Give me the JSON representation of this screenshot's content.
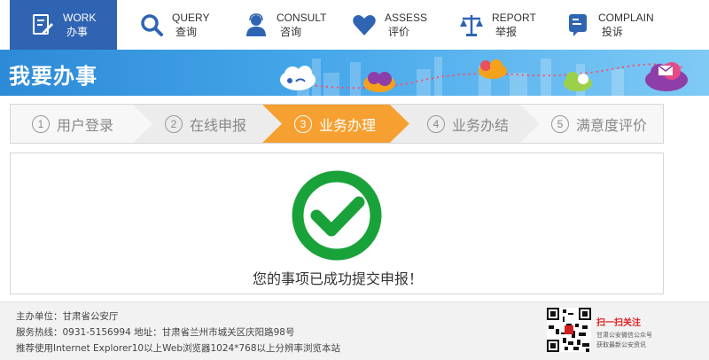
{
  "nav": {
    "items": [
      {
        "en": "WORK",
        "cn": "办事"
      },
      {
        "en": "QUERY",
        "cn": "查询"
      },
      {
        "en": "CONSULT",
        "cn": "咨询"
      },
      {
        "en": "ASSESS",
        "cn": "评价"
      },
      {
        "en": "REPORT",
        "cn": "举报"
      },
      {
        "en": "COMPLAIN",
        "cn": "投诉"
      }
    ],
    "active_index": 0,
    "active_color": "#2f64b3"
  },
  "banner": {
    "title": "我要办事"
  },
  "steps": {
    "items": [
      {
        "num": "1",
        "label": "用户登录"
      },
      {
        "num": "2",
        "label": "在线申报"
      },
      {
        "num": "3",
        "label": "业务办理"
      },
      {
        "num": "4",
        "label": "业务办结"
      },
      {
        "num": "5",
        "label": "满意度评价"
      }
    ],
    "active_index": 2,
    "active_color": "#f5a031"
  },
  "result": {
    "message": "您的事项已成功提交申报！",
    "icon": "check-circle-icon",
    "color": "#1aa23a"
  },
  "footer": {
    "host": "主办单位：甘肃省公安厅",
    "contact": "服务热线：0931-5156994 地址：甘肃省兰州市城关区庆阳路98号",
    "browser": "推荐使用Internet Explorer10以上Web浏览器1024*768以上分辨率浏览本站",
    "follow_title": "扫一扫关注",
    "follow_line1": "甘肃公安微信公众号",
    "follow_line2": "获取最新公安资讯"
  }
}
